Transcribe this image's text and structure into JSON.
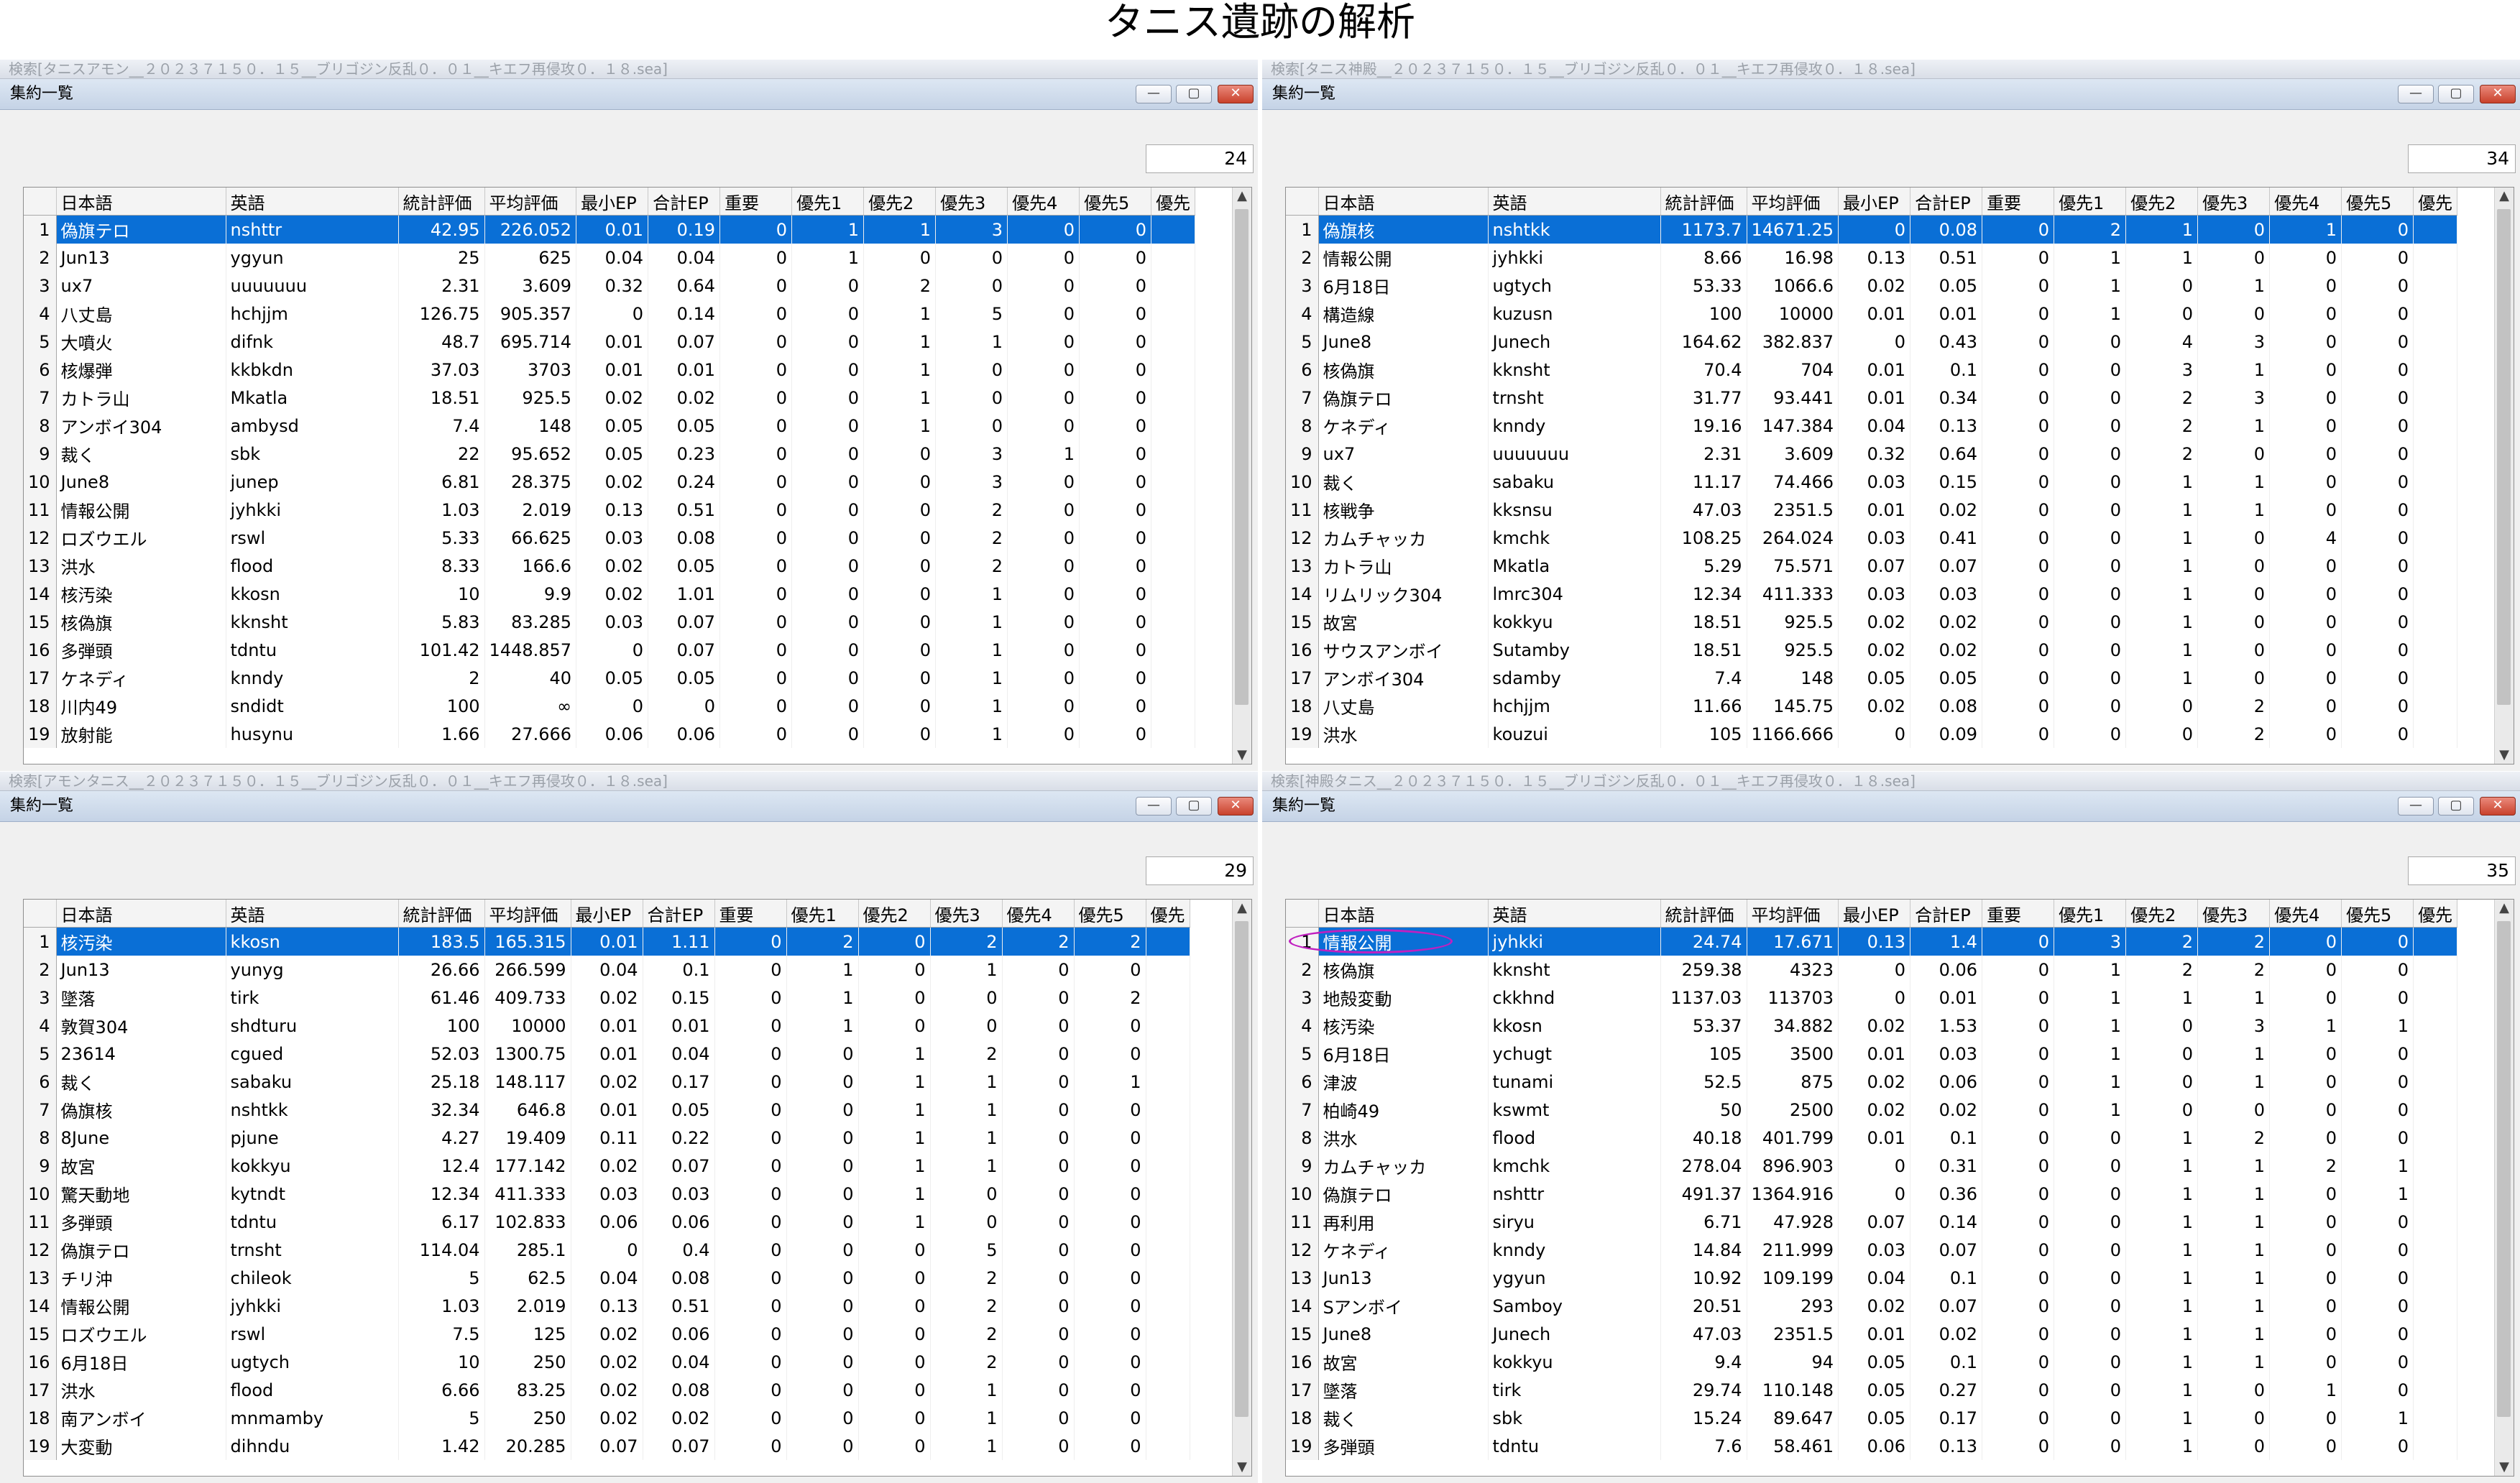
{
  "title": "タニス遺跡の解析",
  "window": {
    "title": "集約一覧",
    "buttons": {
      "minimize": "—",
      "maximize": "▢",
      "close": "✕"
    }
  },
  "columns": [
    "日本語",
    "英語",
    "統計評価",
    "平均評価",
    "最小EP",
    "合計EP",
    "重要",
    "優先1",
    "優先2",
    "優先3",
    "優先4",
    "優先5",
    "優先"
  ],
  "panes": [
    {
      "search": "検索[タニスアモン__２０２３７１５０．１５__ブリゴジン反乱０．０１__キエフ再侵攻０．１８.sea]",
      "count": "24",
      "rows": [
        [
          "1",
          "偽旗テロ",
          "nshttr",
          "42.95",
          "226.052",
          "0.01",
          "0.19",
          "0",
          "1",
          "1",
          "3",
          "0",
          "0"
        ],
        [
          "2",
          "Jun13",
          "ygyun",
          "25",
          "625",
          "0.04",
          "0.04",
          "0",
          "1",
          "0",
          "0",
          "0",
          "0"
        ],
        [
          "3",
          "ux7",
          "uuuuuuu",
          "2.31",
          "3.609",
          "0.32",
          "0.64",
          "0",
          "0",
          "2",
          "0",
          "0",
          "0"
        ],
        [
          "4",
          "八丈島",
          "hchjjm",
          "126.75",
          "905.357",
          "0",
          "0.14",
          "0",
          "0",
          "1",
          "5",
          "0",
          "0"
        ],
        [
          "5",
          "大噴火",
          "difnk",
          "48.7",
          "695.714",
          "0.01",
          "0.07",
          "0",
          "0",
          "1",
          "1",
          "0",
          "0"
        ],
        [
          "6",
          "核爆弾",
          "kkbkdn",
          "37.03",
          "3703",
          "0.01",
          "0.01",
          "0",
          "0",
          "1",
          "0",
          "0",
          "0"
        ],
        [
          "7",
          "カトラ山",
          "Mkatla",
          "18.51",
          "925.5",
          "0.02",
          "0.02",
          "0",
          "0",
          "1",
          "0",
          "0",
          "0"
        ],
        [
          "8",
          "アンボイ304",
          "ambysd",
          "7.4",
          "148",
          "0.05",
          "0.05",
          "0",
          "0",
          "1",
          "0",
          "0",
          "0"
        ],
        [
          "9",
          "裁く",
          "sbk",
          "22",
          "95.652",
          "0.05",
          "0.23",
          "0",
          "0",
          "0",
          "3",
          "1",
          "0"
        ],
        [
          "10",
          "June8",
          "junep",
          "6.81",
          "28.375",
          "0.02",
          "0.24",
          "0",
          "0",
          "0",
          "3",
          "0",
          "0"
        ],
        [
          "11",
          "情報公開",
          "jyhkki",
          "1.03",
          "2.019",
          "0.13",
          "0.51",
          "0",
          "0",
          "0",
          "2",
          "0",
          "0"
        ],
        [
          "12",
          "ロズウエル",
          "rswl",
          "5.33",
          "66.625",
          "0.03",
          "0.08",
          "0",
          "0",
          "0",
          "2",
          "0",
          "0"
        ],
        [
          "13",
          "洪水",
          "flood",
          "8.33",
          "166.6",
          "0.02",
          "0.05",
          "0",
          "0",
          "0",
          "2",
          "0",
          "0"
        ],
        [
          "14",
          "核汚染",
          "kkosn",
          "10",
          "9.9",
          "0.02",
          "1.01",
          "0",
          "0",
          "0",
          "1",
          "0",
          "0"
        ],
        [
          "15",
          "核偽旗",
          "kknsht",
          "5.83",
          "83.285",
          "0.03",
          "0.07",
          "0",
          "0",
          "0",
          "1",
          "0",
          "0"
        ],
        [
          "16",
          "多弾頭",
          "tdntu",
          "101.42",
          "1448.857",
          "0",
          "0.07",
          "0",
          "0",
          "0",
          "1",
          "0",
          "0"
        ],
        [
          "17",
          "ケネディ",
          "knndy",
          "2",
          "40",
          "0.05",
          "0.05",
          "0",
          "0",
          "0",
          "1",
          "0",
          "0"
        ],
        [
          "18",
          "川内49",
          "sndidt",
          "100",
          "∞",
          "0",
          "0",
          "0",
          "0",
          "0",
          "1",
          "0",
          "0"
        ],
        [
          "19",
          "放射能",
          "husynu",
          "1.66",
          "27.666",
          "0.06",
          "0.06",
          "0",
          "0",
          "0",
          "1",
          "0",
          "0"
        ]
      ]
    },
    {
      "search": "検索[タニス神殿__２０２３７１５０．１５__ブリゴジン反乱０．０１__キエフ再侵攻０．１８.sea]",
      "count": "34",
      "rows": [
        [
          "1",
          "偽旗核",
          "nshtkk",
          "1173.7",
          "14671.25",
          "0",
          "0.08",
          "0",
          "2",
          "1",
          "0",
          "1",
          "0"
        ],
        [
          "2",
          "情報公開",
          "jyhkki",
          "8.66",
          "16.98",
          "0.13",
          "0.51",
          "0",
          "1",
          "1",
          "0",
          "0",
          "0"
        ],
        [
          "3",
          "6月18日",
          "ugtych",
          "53.33",
          "1066.6",
          "0.02",
          "0.05",
          "0",
          "1",
          "0",
          "1",
          "0",
          "0"
        ],
        [
          "4",
          "構造線",
          "kuzusn",
          "100",
          "10000",
          "0.01",
          "0.01",
          "0",
          "1",
          "0",
          "0",
          "0",
          "0"
        ],
        [
          "5",
          "June8",
          "Junech",
          "164.62",
          "382.837",
          "0",
          "0.43",
          "0",
          "0",
          "4",
          "3",
          "0",
          "0"
        ],
        [
          "6",
          "核偽旗",
          "kknsht",
          "70.4",
          "704",
          "0.01",
          "0.1",
          "0",
          "0",
          "3",
          "1",
          "0",
          "0"
        ],
        [
          "7",
          "偽旗テロ",
          "trnsht",
          "31.77",
          "93.441",
          "0.01",
          "0.34",
          "0",
          "0",
          "2",
          "3",
          "0",
          "0"
        ],
        [
          "8",
          "ケネディ",
          "knndy",
          "19.16",
          "147.384",
          "0.04",
          "0.13",
          "0",
          "0",
          "2",
          "1",
          "0",
          "0"
        ],
        [
          "9",
          "ux7",
          "uuuuuuu",
          "2.31",
          "3.609",
          "0.32",
          "0.64",
          "0",
          "0",
          "2",
          "0",
          "0",
          "0"
        ],
        [
          "10",
          "裁く",
          "sabaku",
          "11.17",
          "74.466",
          "0.03",
          "0.15",
          "0",
          "0",
          "1",
          "1",
          "0",
          "0"
        ],
        [
          "11",
          "核戦争",
          "kksnsu",
          "47.03",
          "2351.5",
          "0.01",
          "0.02",
          "0",
          "0",
          "1",
          "1",
          "0",
          "0"
        ],
        [
          "12",
          "カムチャッカ",
          "kmchk",
          "108.25",
          "264.024",
          "0.03",
          "0.41",
          "0",
          "0",
          "1",
          "0",
          "4",
          "0"
        ],
        [
          "13",
          "カトラ山",
          "Mkatla",
          "5.29",
          "75.571",
          "0.07",
          "0.07",
          "0",
          "0",
          "1",
          "0",
          "0",
          "0"
        ],
        [
          "14",
          "リムリック304",
          "lmrc304",
          "12.34",
          "411.333",
          "0.03",
          "0.03",
          "0",
          "0",
          "1",
          "0",
          "0",
          "0"
        ],
        [
          "15",
          "故宮",
          "kokkyu",
          "18.51",
          "925.5",
          "0.02",
          "0.02",
          "0",
          "0",
          "1",
          "0",
          "0",
          "0"
        ],
        [
          "16",
          "サウスアンボイ",
          "Sutamby",
          "18.51",
          "925.5",
          "0.02",
          "0.02",
          "0",
          "0",
          "1",
          "0",
          "0",
          "0"
        ],
        [
          "17",
          "アンボイ304",
          "sdamby",
          "7.4",
          "148",
          "0.05",
          "0.05",
          "0",
          "0",
          "1",
          "0",
          "0",
          "0"
        ],
        [
          "18",
          "八丈島",
          "hchjjm",
          "11.66",
          "145.75",
          "0.02",
          "0.08",
          "0",
          "0",
          "0",
          "2",
          "0",
          "0"
        ],
        [
          "19",
          "洪水",
          "kouzui",
          "105",
          "1166.666",
          "0",
          "0.09",
          "0",
          "0",
          "0",
          "2",
          "0",
          "0"
        ]
      ]
    },
    {
      "search": "検索[アモンタニス__２０２３７１５０．１５__ブリゴジン反乱０．０１__キエフ再侵攻０．１８.sea]",
      "count": "29",
      "rows": [
        [
          "1",
          "核汚染",
          "kkosn",
          "183.5",
          "165.315",
          "0.01",
          "1.11",
          "0",
          "2",
          "0",
          "2",
          "2",
          "2"
        ],
        [
          "2",
          "Jun13",
          "yunyg",
          "26.66",
          "266.599",
          "0.04",
          "0.1",
          "0",
          "1",
          "0",
          "1",
          "0",
          "0"
        ],
        [
          "3",
          "墜落",
          "tirk",
          "61.46",
          "409.733",
          "0.02",
          "0.15",
          "0",
          "1",
          "0",
          "0",
          "0",
          "2"
        ],
        [
          "4",
          "敦賀304",
          "shdturu",
          "100",
          "10000",
          "0.01",
          "0.01",
          "0",
          "1",
          "0",
          "0",
          "0",
          "0"
        ],
        [
          "5",
          "23614",
          "cgued",
          "52.03",
          "1300.75",
          "0.01",
          "0.04",
          "0",
          "0",
          "1",
          "2",
          "0",
          "0"
        ],
        [
          "6",
          "裁く",
          "sabaku",
          "25.18",
          "148.117",
          "0.02",
          "0.17",
          "0",
          "0",
          "1",
          "1",
          "0",
          "1"
        ],
        [
          "7",
          "偽旗核",
          "nshtkk",
          "32.34",
          "646.8",
          "0.01",
          "0.05",
          "0",
          "0",
          "1",
          "1",
          "0",
          "0"
        ],
        [
          "8",
          "8June",
          "pjune",
          "4.27",
          "19.409",
          "0.11",
          "0.22",
          "0",
          "0",
          "1",
          "1",
          "0",
          "0"
        ],
        [
          "9",
          "故宮",
          "kokkyu",
          "12.4",
          "177.142",
          "0.02",
          "0.07",
          "0",
          "0",
          "1",
          "1",
          "0",
          "0"
        ],
        [
          "10",
          "驚天動地",
          "kytndt",
          "12.34",
          "411.333",
          "0.03",
          "0.03",
          "0",
          "0",
          "1",
          "0",
          "0",
          "0"
        ],
        [
          "11",
          "多弾頭",
          "tdntu",
          "6.17",
          "102.833",
          "0.06",
          "0.06",
          "0",
          "0",
          "1",
          "0",
          "0",
          "0"
        ],
        [
          "12",
          "偽旗テロ",
          "trnsht",
          "114.04",
          "285.1",
          "0",
          "0.4",
          "0",
          "0",
          "0",
          "5",
          "0",
          "0"
        ],
        [
          "13",
          "チリ沖",
          "chileok",
          "5",
          "62.5",
          "0.04",
          "0.08",
          "0",
          "0",
          "0",
          "2",
          "0",
          "0"
        ],
        [
          "14",
          "情報公開",
          "jyhkki",
          "1.03",
          "2.019",
          "0.13",
          "0.51",
          "0",
          "0",
          "0",
          "2",
          "0",
          "0"
        ],
        [
          "15",
          "ロズウエル",
          "rswl",
          "7.5",
          "125",
          "0.02",
          "0.06",
          "0",
          "0",
          "0",
          "2",
          "0",
          "0"
        ],
        [
          "16",
          "6月18日",
          "ugtych",
          "10",
          "250",
          "0.02",
          "0.04",
          "0",
          "0",
          "0",
          "2",
          "0",
          "0"
        ],
        [
          "17",
          "洪水",
          "flood",
          "6.66",
          "83.25",
          "0.02",
          "0.08",
          "0",
          "0",
          "0",
          "1",
          "0",
          "0"
        ],
        [
          "18",
          "南アンボイ",
          "mnmamby",
          "5",
          "250",
          "0.02",
          "0.02",
          "0",
          "0",
          "0",
          "1",
          "0",
          "0"
        ],
        [
          "19",
          "大変動",
          "dihndu",
          "1.42",
          "20.285",
          "0.07",
          "0.07",
          "0",
          "0",
          "0",
          "1",
          "0",
          "0"
        ]
      ]
    },
    {
      "search": "検索[神殿タニス__２０２３７１５０．１５__ブリゴジン反乱０．０１__キエフ再侵攻０．１８.sea]",
      "count": "35",
      "rows": [
        [
          "1",
          "情報公開",
          "jyhkki",
          "24.74",
          "17.671",
          "0.13",
          "1.4",
          "0",
          "3",
          "2",
          "2",
          "0",
          "0"
        ],
        [
          "2",
          "核偽旗",
          "kknsht",
          "259.38",
          "4323",
          "0",
          "0.06",
          "0",
          "1",
          "2",
          "2",
          "0",
          "0"
        ],
        [
          "3",
          "地殻変動",
          "ckkhnd",
          "1137.03",
          "113703",
          "0",
          "0.01",
          "0",
          "1",
          "1",
          "1",
          "0",
          "0"
        ],
        [
          "4",
          "核汚染",
          "kkosn",
          "53.37",
          "34.882",
          "0.02",
          "1.53",
          "0",
          "1",
          "0",
          "3",
          "1",
          "1"
        ],
        [
          "5",
          "6月18日",
          "ychugt",
          "105",
          "3500",
          "0.01",
          "0.03",
          "0",
          "1",
          "0",
          "1",
          "0",
          "0"
        ],
        [
          "6",
          "津波",
          "tunami",
          "52.5",
          "875",
          "0.02",
          "0.06",
          "0",
          "1",
          "0",
          "1",
          "0",
          "0"
        ],
        [
          "7",
          "柏崎49",
          "kswmt",
          "50",
          "2500",
          "0.02",
          "0.02",
          "0",
          "1",
          "0",
          "0",
          "0",
          "0"
        ],
        [
          "8",
          "洪水",
          "flood",
          "40.18",
          "401.799",
          "0.01",
          "0.1",
          "0",
          "0",
          "1",
          "2",
          "0",
          "0"
        ],
        [
          "9",
          "カムチャッカ",
          "kmchk",
          "278.04",
          "896.903",
          "0",
          "0.31",
          "0",
          "0",
          "1",
          "1",
          "2",
          "1"
        ],
        [
          "10",
          "偽旗テロ",
          "nshttr",
          "491.37",
          "1364.916",
          "0",
          "0.36",
          "0",
          "0",
          "1",
          "1",
          "0",
          "1"
        ],
        [
          "11",
          "再利用",
          "siryu",
          "6.71",
          "47.928",
          "0.07",
          "0.14",
          "0",
          "0",
          "1",
          "1",
          "0",
          "0"
        ],
        [
          "12",
          "ケネディ",
          "knndy",
          "14.84",
          "211.999",
          "0.03",
          "0.07",
          "0",
          "0",
          "1",
          "1",
          "0",
          "0"
        ],
        [
          "13",
          "Jun13",
          "ygyun",
          "10.92",
          "109.199",
          "0.04",
          "0.1",
          "0",
          "0",
          "1",
          "1",
          "0",
          "0"
        ],
        [
          "14",
          "Sアンボイ",
          "Samboy",
          "20.51",
          "293",
          "0.02",
          "0.07",
          "0",
          "0",
          "1",
          "1",
          "0",
          "0"
        ],
        [
          "15",
          "June8",
          "Junech",
          "47.03",
          "2351.5",
          "0.01",
          "0.02",
          "0",
          "0",
          "1",
          "1",
          "0",
          "0"
        ],
        [
          "16",
          "故宮",
          "kokkyu",
          "9.4",
          "94",
          "0.05",
          "0.1",
          "0",
          "0",
          "1",
          "1",
          "0",
          "0"
        ],
        [
          "17",
          "墜落",
          "tirk",
          "29.74",
          "110.148",
          "0.05",
          "0.27",
          "0",
          "0",
          "1",
          "0",
          "1",
          "0"
        ],
        [
          "18",
          "裁く",
          "sbk",
          "15.24",
          "89.647",
          "0.05",
          "0.17",
          "0",
          "0",
          "1",
          "0",
          "0",
          "1"
        ],
        [
          "19",
          "多弾頭",
          "tdntu",
          "7.6",
          "58.461",
          "0.06",
          "0.13",
          "0",
          "0",
          "1",
          "0",
          "0",
          "0"
        ]
      ]
    }
  ]
}
